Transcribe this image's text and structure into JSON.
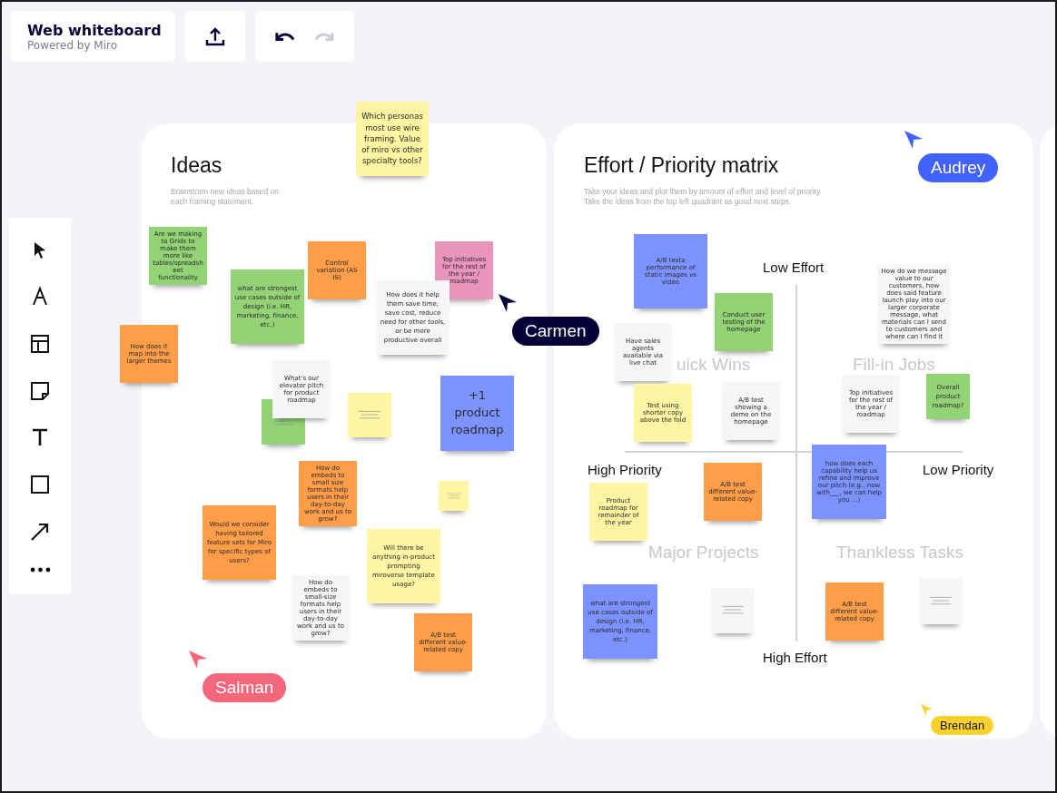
{
  "header": {
    "title": "Web whiteboard",
    "subtitle": "Powered by Miro"
  },
  "history": {
    "undo": {
      "disabled": false
    },
    "redo": {
      "disabled": true
    }
  },
  "tools": [
    {
      "kind": "select"
    },
    {
      "kind": "pen"
    },
    {
      "kind": "template"
    },
    {
      "kind": "sticky"
    },
    {
      "kind": "text"
    },
    {
      "kind": "shape"
    },
    {
      "kind": "arrow"
    },
    {
      "kind": "more"
    }
  ],
  "frames": [
    {
      "title": "Ideas",
      "description": "Brainstorm new ideas based on each framing statement.",
      "notes": [
        {
          "text": "Which personas most use wire framing. Value of miro vs other specialty tools?",
          "color": "#fff6a3"
        },
        {
          "text": "Are we making to Grids to make them more like tables/spreadsheet functionality",
          "color": "#93d275"
        },
        {
          "text": "what are strongest use cases outside of design (i.e. HR, marketing, finance, etc.)",
          "color": "#93d275"
        },
        {
          "text": "Control variation (AS IS)",
          "color": "#ff9d48"
        },
        {
          "text": "Top initiatives for the rest of the year / roadmap",
          "color": "#ea94bb"
        },
        {
          "text": "How does it help them save time, save cost, reduce need for other tools, or be more productive overall",
          "color": "#f5f6f8"
        },
        {
          "text": "How does it map into the larger themes",
          "color": "#ff9d48"
        },
        {
          "color": "#93d275"
        },
        {
          "text": "What's our elevator pitch for product roadmap",
          "color": "#f5f6f8"
        },
        {
          "color": "#fff6a3"
        },
        {
          "text": "+1 product roadmap",
          "color": "#7b92ff"
        },
        {
          "text": "How do embeds to small size formats help users in their day-to-day work and us to grow?",
          "color": "#ff9d48"
        },
        {
          "color": "#fff6a3"
        },
        {
          "text": "Would we consider having tailored feature sets for Miro for specific types of users?",
          "color": "#ff9d48"
        },
        {
          "text": "Will there be anything in-product prompting miroverse template usage?",
          "color": "#fff6a3"
        },
        {
          "text": "How do embeds to small-size formats help users in their day-to-day work and us to grow?",
          "color": "#f5f6f8"
        },
        {
          "text": "A/B test different value-related copy",
          "color": "#ff9d48"
        }
      ]
    },
    {
      "title": "Effort / Priority matrix",
      "description": "Take your ideas and plot them by amount of effort and level of priority. Take the ideas from the top left quadrant as good next steps.",
      "axis_labels": [
        "Low Effort",
        "High Priority",
        "Low Priority",
        "High Effort"
      ],
      "quadrants": [
        "uick Wins",
        "Fill-in Jobs",
        "Major Projects",
        "Thankless Tasks"
      ],
      "notes": [
        {
          "text": "A/B testa performance of static images vs video",
          "color": "#7b92ff"
        },
        {
          "text": "Conduct user testing of the homepage",
          "color": "#93d275"
        },
        {
          "text": "How do we message value to our customers, how does said feature launch play into our larger corporate message, what materials can I send to customers and where can I find it",
          "color": "#f5f6f8"
        },
        {
          "text": "Have sales agents available via live chat",
          "color": "#f5f6f8"
        },
        {
          "text": "Test using shorter copy above the fold",
          "color": "#fff6a3"
        },
        {
          "text": "A/B test showing a demo on the homepage",
          "color": "#f5f6f8"
        },
        {
          "text": "Top initiatives for the rest of the year / roadmap",
          "color": "#f5f6f8"
        },
        {
          "text": "Overall product roadmap?",
          "color": "#93d275"
        },
        {
          "text": "A/B test different value-related copy",
          "color": "#ff9d48"
        },
        {
          "text": "how does each capability help us refine and improve our pitch (e.g., now with___, we can help you ...)",
          "color": "#7b92ff"
        },
        {
          "text": "Product roadmap for remainder of the year",
          "color": "#fff6a3"
        },
        {
          "text": "what are strongest use cases outside of design (i.e. HR, marketing, finance, etc.)",
          "color": "#7b92ff"
        },
        {
          "color": "#f5f6f8"
        },
        {
          "text": "A/B test different value-related copy",
          "color": "#ff9d48"
        },
        {
          "color": "#f5f6f8"
        }
      ]
    }
  ],
  "cursors": [
    {
      "name": "Audrey",
      "color": "#4262ff"
    },
    {
      "name": "Carmen",
      "color": "#050038"
    },
    {
      "name": "Salman",
      "color": "#f4677a"
    },
    {
      "name": "Brendan",
      "color": "#fcd12a"
    }
  ]
}
